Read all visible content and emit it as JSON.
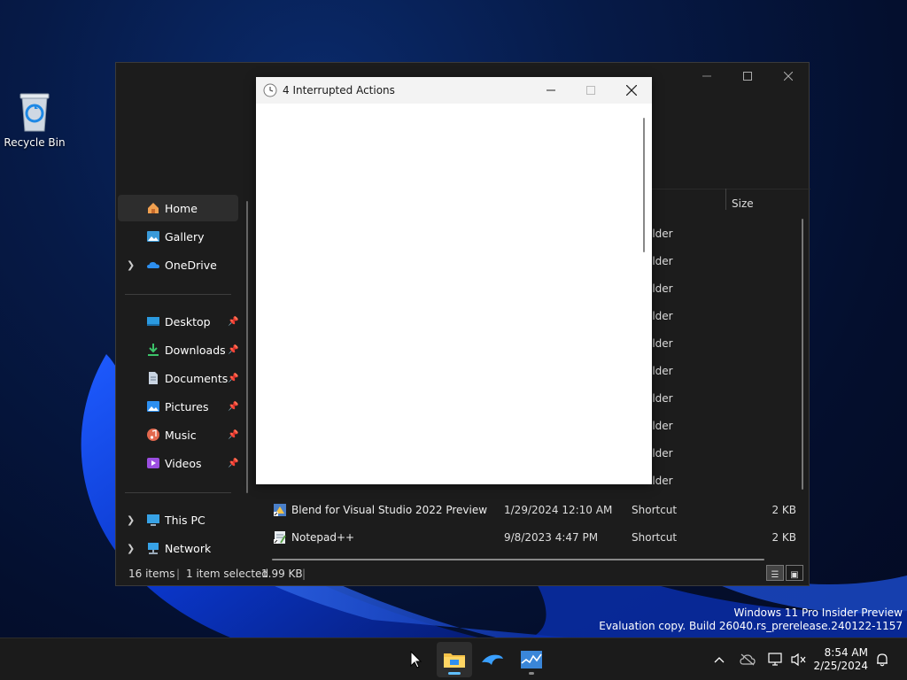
{
  "desktop": {
    "recycle_bin_label": "Recycle Bin",
    "watermark_line1": "Windows 11 Pro Insider Preview",
    "watermark_line2": "Evaluation copy. Build 26040.rs_prerelease.240122-1157"
  },
  "explorer": {
    "sidebar": {
      "items": [
        {
          "label": "Home"
        },
        {
          "label": "Gallery"
        },
        {
          "label": "OneDrive"
        },
        {
          "label": "Desktop"
        },
        {
          "label": "Downloads"
        },
        {
          "label": "Documents"
        },
        {
          "label": "Pictures"
        },
        {
          "label": "Music"
        },
        {
          "label": "Videos"
        },
        {
          "label": "This PC"
        },
        {
          "label": "Network"
        }
      ]
    },
    "columns": {
      "size": "Size"
    },
    "folder_type": "older",
    "rows": [
      {
        "name": "Blend for Visual Studio 2022 Preview",
        "date": "1/29/2024 12:10 AM",
        "type": "Shortcut",
        "size": "2 KB"
      },
      {
        "name": "Notepad++",
        "date": "9/8/2023 4:47 PM",
        "type": "Shortcut",
        "size": "2 KB"
      }
    ],
    "status": {
      "items": "16 items",
      "selected": "1 item selected",
      "size": "1.99 KB",
      "sep": "|"
    }
  },
  "dialog": {
    "title": "4 Interrupted Actions"
  },
  "taskbar": {
    "time": "8:54 AM",
    "date": "2/25/2024"
  },
  "colors": {
    "accent": "#60c0ff",
    "explorer_bg": "#1c1c1c",
    "taskbar_bg": "#1b1b1b"
  }
}
